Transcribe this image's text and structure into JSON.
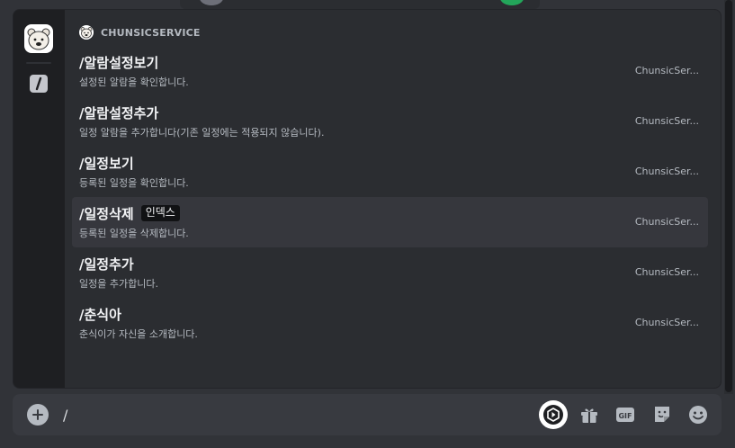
{
  "section": {
    "bot_name": "CHUNSICSERVICE"
  },
  "commands": [
    {
      "title": "/알람설정보기",
      "desc": "설정된 알람을 확인합니다.",
      "source": "ChunsicSer...",
      "option": ""
    },
    {
      "title": "/알람설정추가",
      "desc": "일정 알람을 추가합니다(기존 일정에는 적용되지 않습니다).",
      "source": "ChunsicSer...",
      "option": ""
    },
    {
      "title": "/일정보기",
      "desc": "등록된 일정을 확인합니다.",
      "source": "ChunsicSer...",
      "option": ""
    },
    {
      "title": "/일정삭제",
      "desc": "등록된 일정을 삭제합니다.",
      "source": "ChunsicSer...",
      "option": "인덱스"
    },
    {
      "title": "/일정추가",
      "desc": "일정을 추가합니다.",
      "source": "ChunsicSer...",
      "option": ""
    },
    {
      "title": "/춘식아",
      "desc": "춘식이가 자신을 소개합니다.",
      "source": "ChunsicSer...",
      "option": ""
    }
  ],
  "selected_index": 3,
  "message_bar": {
    "value": "/"
  },
  "icons": {
    "add": "plus-circle-icon",
    "apps": "app-launcher-icon",
    "gift": "gift-icon",
    "gif": "gif-icon",
    "sticker": "sticker-icon",
    "emoji": "emoji-icon"
  },
  "colors": {
    "background": "#313338",
    "popup": "#2b2d31",
    "rail": "#1e1f22",
    "selected_row": "#36373d",
    "input_bar": "#383a40"
  }
}
